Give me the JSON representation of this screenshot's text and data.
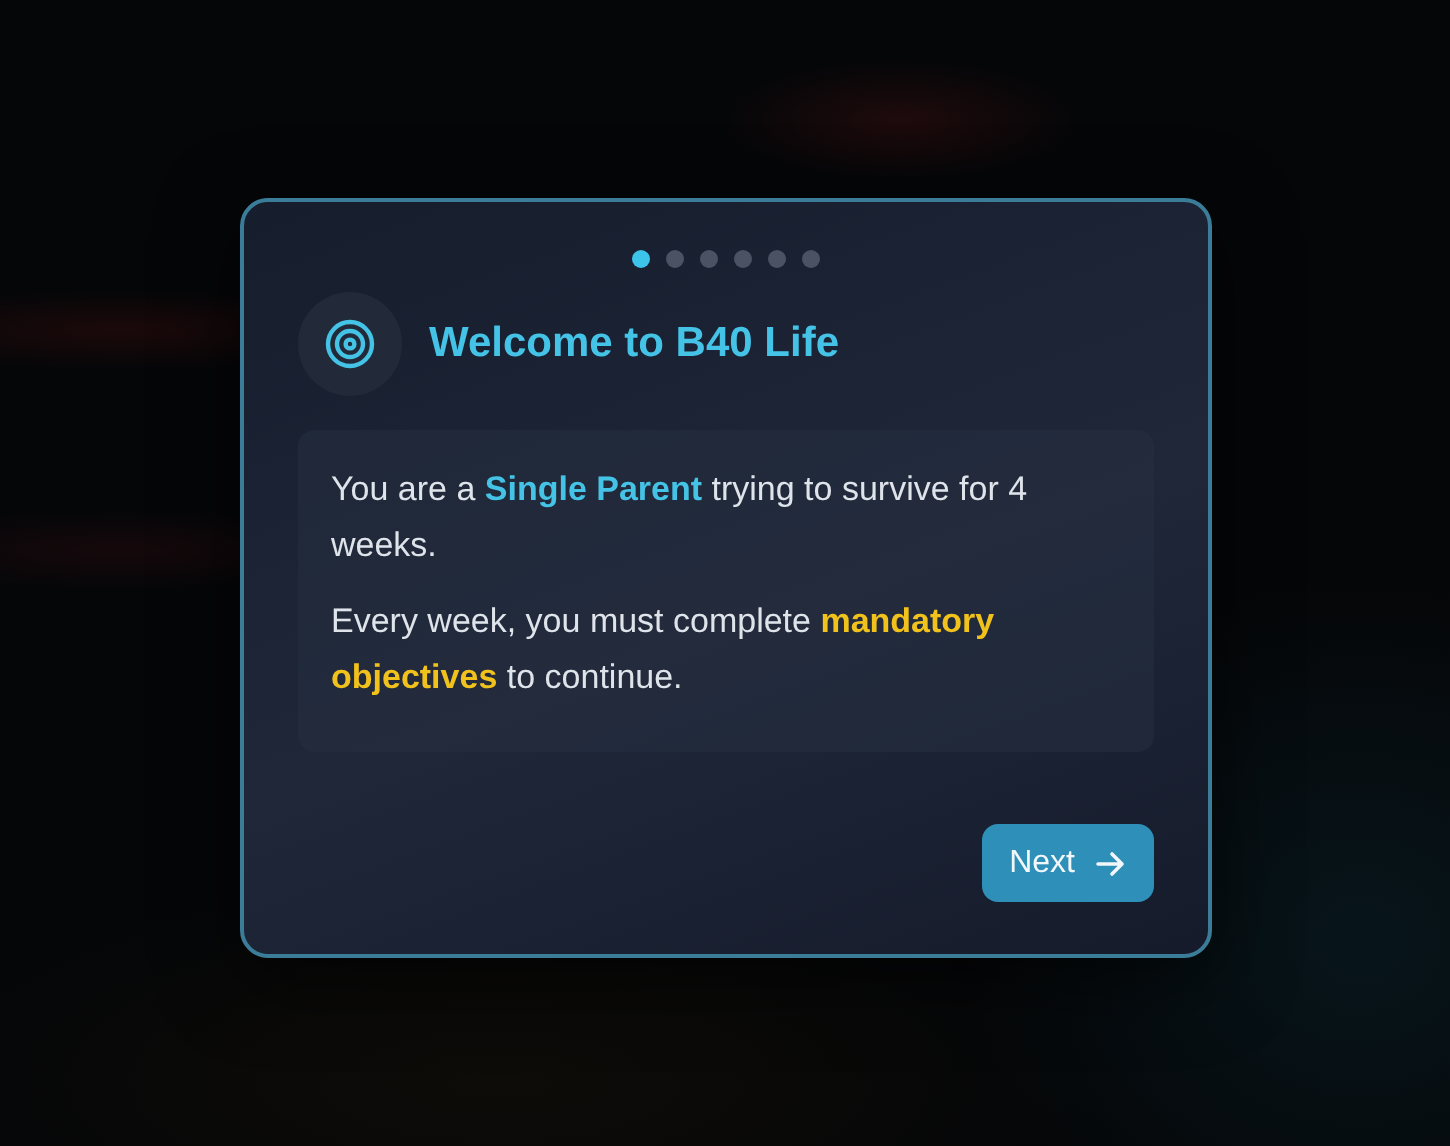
{
  "steps": [
    {
      "selected": true
    },
    {
      "selected": false
    },
    {
      "selected": false
    },
    {
      "selected": false
    },
    {
      "selected": false
    },
    {
      "selected": false
    }
  ],
  "title": "Welcome to B40 Life",
  "paragraphs": [
    [
      {
        "text": "You are a ",
        "kind": "plain"
      },
      {
        "text": "Single Parent",
        "kind": "accent"
      },
      {
        "text": " trying to survive for 4 weeks.",
        "kind": "plain"
      }
    ],
    [
      {
        "text": "Every week, you must complete ",
        "kind": "plain"
      },
      {
        "text": "mandatory objectives",
        "kind": "warning"
      },
      {
        "text": " to continue.",
        "kind": "plain"
      }
    ]
  ],
  "button": {
    "label": "Next"
  }
}
